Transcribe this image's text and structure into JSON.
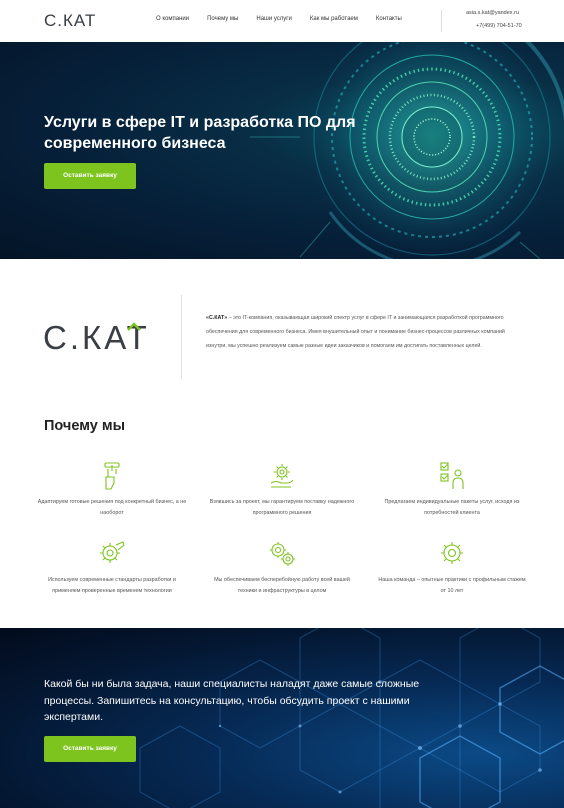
{
  "header": {
    "logo_text": "С.КАТ",
    "nav": [
      "О компании",
      "Почему мы",
      "Наши услуги",
      "Как мы работаем",
      "Контакты"
    ],
    "email": "asia.s.kat@yandex.ru",
    "phone": "+7(499) 704-51-70"
  },
  "hero": {
    "title": "Услуги в сфере IT и разработка ПО для современного бизнеса",
    "button": "Оставить заявку"
  },
  "about": {
    "logo_text": "С.КАТ",
    "company": "«С.КАТ»",
    "text": " – это IT-компания, оказывающая широкий спектр услуг в сфере IT и занимающаяся разработкой программного обеспечения для современного бизнеса. Имея внушительный опыт и понимание бизнес-процессов различных компаний изнутри, мы успешно реализуем самые разные идеи заказчиков и помогаем им достигать поставленных целей."
  },
  "why": {
    "title": "Почему мы",
    "features": [
      {
        "icon": "sliders-icon",
        "text": "Адаптируем готовые решения под конкретный бизнес, а не наоборот"
      },
      {
        "icon": "gear-hand-icon",
        "text": "Взявшись за проект, мы гарантируем поставку надежного программного решения"
      },
      {
        "icon": "checklist-person-icon",
        "text": "Предлагаем индивидуальные пакеты услуг, исходя из потребностей клиента"
      },
      {
        "icon": "gear-wrench-icon",
        "text": "Используем современные стандарты разработки и применяем проверенные временем технологии"
      },
      {
        "icon": "gears-icon",
        "text": "Мы обеспечиваем бесперебойную работу всей вашей техники и инфраструктуры в целом"
      },
      {
        "icon": "team-gear-icon",
        "text": "Наша команда – опытные практики с профильным стажем от 10 лет"
      }
    ]
  },
  "cta": {
    "text": "Какой бы ни была задача, наши специалисты наладят даже самые сложные процессы. Запишитесь на консультацию, чтобы обсудить проект с нашими экспертами.",
    "button": "Оставить заявку"
  },
  "colors": {
    "accent": "#7dc41f",
    "dark": "#3a3f45"
  }
}
